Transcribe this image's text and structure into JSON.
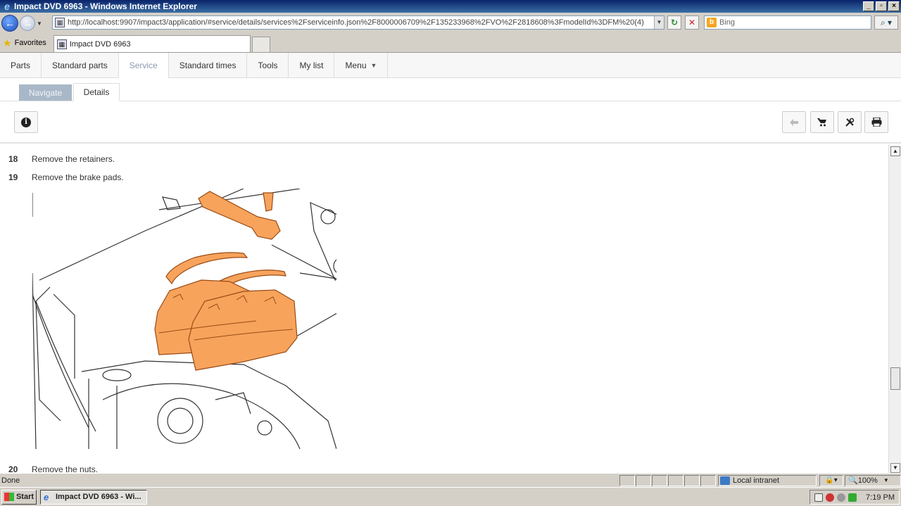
{
  "window": {
    "title": "Impact DVD 6963 - Windows Internet Explorer",
    "min": "_",
    "max": "▫",
    "close": "×"
  },
  "address": {
    "url": "http://localhost:9907/impact3/application/#service/details/services%2Fserviceinfo.json%2F8000006709%2F135233968%2FVO%2F2818608%3FmodelId%3DFM%20(4)",
    "search_placeholder": "Bing"
  },
  "favorites": {
    "label": "Favorites",
    "tab_title": "Impact DVD 6963"
  },
  "app_nav": {
    "items": [
      "Parts",
      "Standard parts",
      "Service",
      "Standard times",
      "Tools",
      "My list",
      "Menu"
    ],
    "active": "Service"
  },
  "sub_tabs": {
    "navigate": "Navigate",
    "details": "Details"
  },
  "steps": [
    {
      "num": "18",
      "text": "Remove the retainers."
    },
    {
      "num": "19",
      "text": "Remove the brake pads."
    },
    {
      "num": "20",
      "text": "Remove the nuts."
    }
  ],
  "status": {
    "text": "Done",
    "zone": "Local intranet",
    "zoom": "100%"
  },
  "taskbar": {
    "start": "Start",
    "task": "Impact DVD 6963 - Wi...",
    "clock": "7:19 PM"
  },
  "colors": {
    "highlight_part": "#f7a35c",
    "title_bar": "#0a246a",
    "active_nav": "#8a9ab0"
  }
}
